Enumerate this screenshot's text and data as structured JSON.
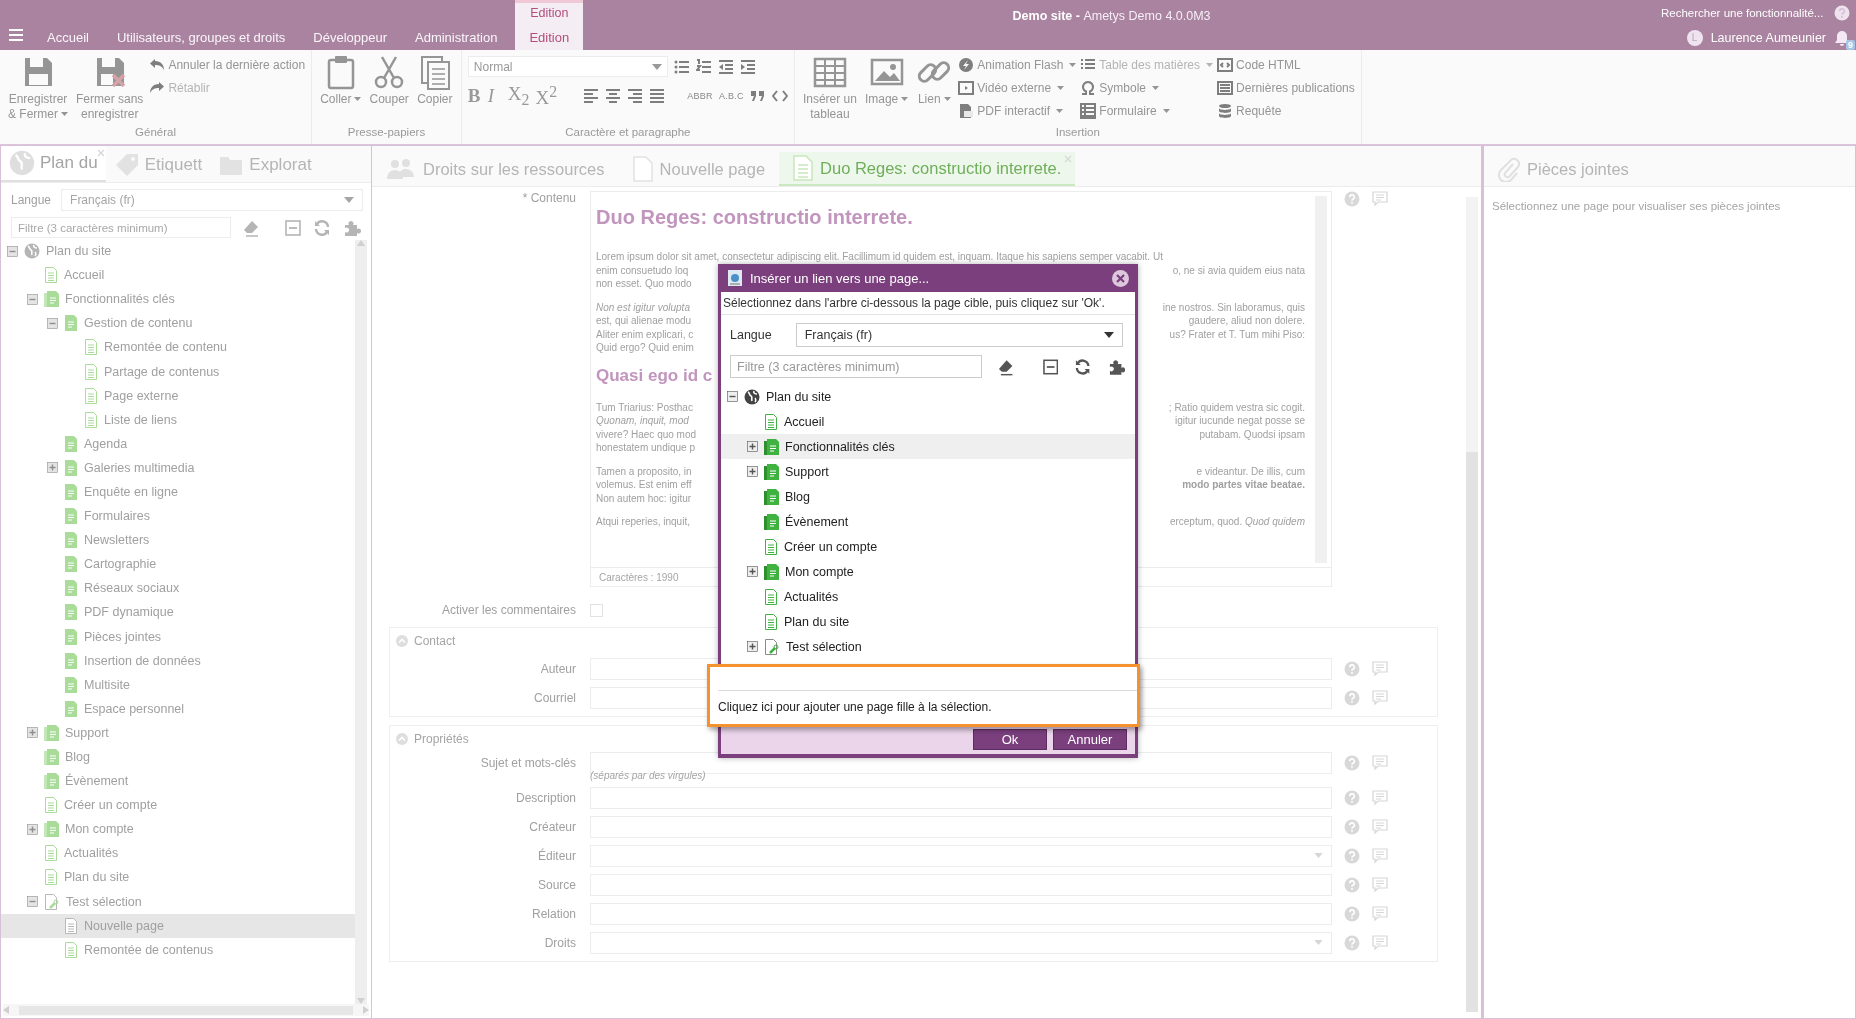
{
  "topbar": {
    "contextual_group": "Edition",
    "tabs": [
      {
        "label": "Accueil",
        "selected": false
      },
      {
        "label": "Utilisateurs, groupes et droits",
        "selected": false
      },
      {
        "label": "Développeur",
        "selected": false
      },
      {
        "label": "Administration",
        "selected": false
      },
      {
        "label": "Edition",
        "selected": true
      }
    ],
    "site_name": "Demo site - ",
    "app_name": "Ametys Demo 4.0.0M3",
    "search": {
      "placeholder": "Rechercher une fonctionnalité..."
    },
    "user": {
      "initial": "L",
      "name": "Laurence Aumeunier"
    },
    "notifications": "9"
  },
  "ribbon": [
    {
      "kind": "buttons",
      "title": "Général",
      "large": [
        {
          "lines": [
            "Enregistrer",
            "& Fermer"
          ],
          "dropdown": true
        },
        {
          "lines": [
            "Fermer sans",
            "enregistrer"
          ],
          "dropdown": false
        }
      ],
      "small_columns": [
        [
          {
            "label": "Annuler la dernière action",
            "dropdown": false,
            "disabled": false
          },
          {
            "label": "Rétablir",
            "dropdown": false,
            "disabled": true
          }
        ]
      ]
    },
    {
      "kind": "buttons",
      "title": "Presse-papiers",
      "large": [
        {
          "lines": [
            "Coller"
          ],
          "dropdown": true
        },
        {
          "lines": [
            "Couper"
          ],
          "dropdown": false
        },
        {
          "lines": [
            "Copier"
          ],
          "dropdown": false
        }
      ]
    },
    {
      "kind": "format",
      "title": "Caractère et paragraphe",
      "style": "Normal",
      "glyphs": [
        "B",
        "I",
        "X$_{2}$",
        "X$^{2}$"
      ],
      "tags": [
        "ABBR",
        "A.B.C"
      ]
    },
    {
      "kind": "buttons",
      "title": "Insertion",
      "large": [
        {
          "lines": [
            "Insérer un",
            "tableau"
          ],
          "dropdown": false
        },
        {
          "lines": [
            "Image"
          ],
          "dropdown": true
        },
        {
          "lines": [
            "Lien"
          ],
          "dropdown": true
        }
      ],
      "small_columns": [
        [
          {
            "label": "Animation Flash",
            "dropdown": true,
            "disabled": false
          },
          {
            "label": "Vidéo externe",
            "dropdown": true,
            "disabled": false
          },
          {
            "label": "PDF interactif",
            "dropdown": true,
            "disabled": false
          }
        ],
        [
          {
            "label": "Table des matières",
            "dropdown": true,
            "disabled": true
          },
          {
            "label": "Symbole",
            "dropdown": true,
            "disabled": false
          },
          {
            "label": "Formulaire",
            "dropdown": true,
            "disabled": false
          }
        ],
        [
          {
            "label": "Code HTML",
            "dropdown": false,
            "disabled": false
          },
          {
            "label": "Dernières publications",
            "dropdown": false,
            "disabled": false
          },
          {
            "label": "Requête",
            "dropdown": false,
            "disabled": false
          }
        ]
      ]
    }
  ],
  "sitemap_panel": {
    "tabs": [
      {
        "label": "Plan du",
        "selected": true
      },
      {
        "label": "Etiquett",
        "selected": false
      },
      {
        "label": "Explorat",
        "selected": false
      }
    ],
    "language_label": "Langue",
    "language_value": "Français (fr)",
    "filter_placeholder": "Filtre (3 caractères minimum)",
    "tree": [
      {
        "label": "Plan du site",
        "kind": "globe",
        "expandable": true,
        "expanded": true,
        "selected": false,
        "children": [
          {
            "label": "Accueil",
            "kind": "page",
            "expandable": false,
            "expanded": false,
            "selected": false
          },
          {
            "label": "Fonctionnalités clés",
            "kind": "section",
            "expandable": true,
            "expanded": true,
            "selected": false,
            "children": [
              {
                "label": "Gestion de contenu",
                "kind": "filled",
                "expandable": true,
                "expanded": true,
                "selected": false,
                "children": [
                  {
                    "label": "Remontée de contenu",
                    "kind": "page",
                    "expandable": false,
                    "expanded": false,
                    "selected": false
                  },
                  {
                    "label": "Partage de contenus",
                    "kind": "page",
                    "expandable": false,
                    "expanded": false,
                    "selected": false
                  },
                  {
                    "label": "Page externe",
                    "kind": "page",
                    "expandable": false,
                    "expanded": false,
                    "selected": false
                  },
                  {
                    "label": "Liste de liens",
                    "kind": "page",
                    "expandable": false,
                    "expanded": false,
                    "selected": false
                  }
                ]
              },
              {
                "label": "Agenda",
                "kind": "filled",
                "expandable": false,
                "expanded": false,
                "selected": false
              },
              {
                "label": "Galeries multimedia",
                "kind": "filled",
                "expandable": true,
                "expanded": false,
                "selected": false
              },
              {
                "label": "Enquête en ligne",
                "kind": "filled",
                "expandable": false,
                "expanded": false,
                "selected": false
              },
              {
                "label": "Formulaires",
                "kind": "filled",
                "expandable": false,
                "expanded": false,
                "selected": false
              },
              {
                "label": "Newsletters",
                "kind": "filled",
                "expandable": false,
                "expanded": false,
                "selected": false
              },
              {
                "label": "Cartographie",
                "kind": "filled",
                "expandable": false,
                "expanded": false,
                "selected": false
              },
              {
                "label": "Réseaux sociaux",
                "kind": "filled",
                "expandable": false,
                "expanded": false,
                "selected": false
              },
              {
                "label": "PDF dynamique",
                "kind": "filled",
                "expandable": false,
                "expanded": false,
                "selected": false
              },
              {
                "label": "Pièces jointes",
                "kind": "filled",
                "expandable": false,
                "expanded": false,
                "selected": false
              },
              {
                "label": "Insertion de données",
                "kind": "filled",
                "expandable": false,
                "expanded": false,
                "selected": false
              },
              {
                "label": "Multisite",
                "kind": "filled",
                "expandable": false,
                "expanded": false,
                "selected": false
              },
              {
                "label": "Espace personnel",
                "kind": "filled",
                "expandable": false,
                "expanded": false,
                "selected": false
              }
            ]
          },
          {
            "label": "Support",
            "kind": "section",
            "expandable": true,
            "expanded": false,
            "selected": false
          },
          {
            "label": "Blog",
            "kind": "section",
            "expandable": false,
            "expanded": false,
            "selected": false
          },
          {
            "label": "Évènement",
            "kind": "section",
            "expandable": false,
            "expanded": false,
            "selected": false
          },
          {
            "label": "Créer un compte",
            "kind": "page",
            "expandable": false,
            "expanded": false,
            "selected": false
          },
          {
            "label": "Mon compte",
            "kind": "section",
            "expandable": true,
            "expanded": false,
            "selected": false
          },
          {
            "label": "Actualités",
            "kind": "page",
            "expandable": false,
            "expanded": false,
            "selected": false
          },
          {
            "label": "Plan du site",
            "kind": "page",
            "expandable": false,
            "expanded": false,
            "selected": false
          },
          {
            "label": "Test sélection",
            "kind": "link",
            "expandable": true,
            "expanded": true,
            "selected": false,
            "children": [
              {
                "label": "Nouvelle page",
                "kind": "draft",
                "expandable": false,
                "expanded": false,
                "selected": true
              },
              {
                "label": "Remontée de contenus",
                "kind": "page",
                "expandable": false,
                "expanded": false,
                "selected": false
              }
            ]
          }
        ]
      }
    ]
  },
  "editor_panel": {
    "tabs": [
      {
        "label": "Droits sur les ressources",
        "selected": false
      },
      {
        "label": "Nouvelle page",
        "selected": false
      },
      {
        "label": "Duo Reges: constructio interrete.",
        "selected": true
      }
    ],
    "content_label": "* Contenu",
    "blocks": [
      {
        "kind": "heading",
        "text": "Duo Reges: constructio interrete."
      },
      {
        "kind": "paragraph",
        "lines": [
          {
            "left": "Lorem ipsum dolor sit amet, consectetur adipiscing elit. Facillimum id quidem est, inquam. Itaque his sapiens semper vacabit. Ut"
          },
          {
            "left": "enim consuetudo loq",
            "right": "o, ne si avia quidem eius nata"
          },
          {
            "left": "non esset. Quo modo"
          }
        ]
      },
      {
        "kind": "paragraph",
        "lines": [
          {
            "left": "*Non est igitur volupta*",
            "right": "ine nostros. Sin laboramus, quis"
          },
          {
            "left": "est, qui alienae modu",
            "right": "gaudere, aliud non dolere."
          },
          {
            "left": "Aliter enim explicari, c",
            "right": "us? Frater et T. Tum mihi Piso:"
          },
          {
            "left": "Quid ergo? Quid enim"
          }
        ]
      },
      {
        "kind": "heading",
        "text": "Quasi ego id c"
      },
      {
        "kind": "paragraph",
        "lines": [
          {
            "left": "Tum Triarius: Posthac",
            "right": "; Ratio quidem vestra sic cogit."
          },
          {
            "left": "*Quonam, inquit, mod*",
            "right": "igitur iucunde negat posse se"
          },
          {
            "left": "vivere? Haec quo mod",
            "right": "putabam. Quodsi ipsam"
          },
          {
            "left": "honestatem undique p"
          }
        ]
      },
      {
        "kind": "paragraph",
        "lines": [
          {
            "left": "Tamen a proposito, in",
            "right": "e videantur. De illis, cum"
          },
          {
            "left": "volemus. Est enim eff",
            "right": "**modo partes vitae beatae.**"
          },
          {
            "left": "Non autem hoc: igitur"
          }
        ]
      },
      {
        "kind": "paragraph",
        "lines": [
          {
            "left": "Atqui reperies, inquit,",
            "right": "erceptum, quod. *Quod quidem*"
          }
        ]
      }
    ],
    "char_count": "Caractères : 1990",
    "comments": {
      "label": "Activer les commentaires",
      "checked": false
    },
    "sections": [
      {
        "title": "Contact",
        "expanded": true,
        "fields": [
          {
            "label": "Auteur",
            "kind": "text"
          },
          {
            "label": "Courriel",
            "kind": "text"
          }
        ]
      },
      {
        "title": "Propriétés",
        "expanded": true,
        "fields": [
          {
            "label": "Sujet et mots-clés",
            "kind": "text",
            "hint": "(séparés par des virgules)"
          },
          {
            "label": "Description",
            "kind": "text"
          },
          {
            "label": "Créateur",
            "kind": "text"
          },
          {
            "label": "Éditeur",
            "kind": "combo"
          },
          {
            "label": "Source",
            "kind": "text"
          },
          {
            "label": "Relation",
            "kind": "text"
          },
          {
            "label": "Droits",
            "kind": "combo"
          }
        ]
      }
    ]
  },
  "attachments_panel": {
    "tab": "Pièces jointes",
    "message": "Sélectionnez une page pour visualiser ses pièces jointes"
  },
  "dialog": {
    "title": "Insérer un lien vers une page...",
    "instruction": "Sélectionnez dans l'arbre ci-dessous la page cible, puis cliquez sur 'Ok'.",
    "language_label": "Langue",
    "language_value": "Français (fr)",
    "filter_placeholder": "Filtre (3 caractères minimum)",
    "tree": [
      {
        "label": "Plan du site",
        "kind": "globe",
        "expandable": true,
        "expanded": true,
        "selected": false,
        "children": [
          {
            "label": "Accueil",
            "kind": "page",
            "expandable": false,
            "expanded": false,
            "selected": false
          },
          {
            "label": "Fonctionnalités clés",
            "kind": "section",
            "expandable": true,
            "expanded": false,
            "selected": true
          },
          {
            "label": "Support",
            "kind": "section",
            "expandable": true,
            "expanded": false,
            "selected": false
          },
          {
            "label": "Blog",
            "kind": "section",
            "expandable": false,
            "expanded": false,
            "selected": false
          },
          {
            "label": "Évènement",
            "kind": "section",
            "expandable": false,
            "expanded": false,
            "selected": false
          },
          {
            "label": "Créer un compte",
            "kind": "page",
            "expandable": false,
            "expanded": false,
            "selected": false
          },
          {
            "label": "Mon compte",
            "kind": "section",
            "expandable": true,
            "expanded": false,
            "selected": false
          },
          {
            "label": "Actualités",
            "kind": "page",
            "expandable": false,
            "expanded": false,
            "selected": false
          },
          {
            "label": "Plan du site",
            "kind": "page",
            "expandable": false,
            "expanded": false,
            "selected": false
          },
          {
            "label": "Test sélection",
            "kind": "link",
            "expandable": true,
            "expanded": false,
            "selected": false
          }
        ]
      }
    ],
    "buttons": [
      "Ok",
      "Annuler"
    ]
  },
  "callout": {
    "text": "Cliquez ici pour ajouter une page fille à la sélection."
  }
}
